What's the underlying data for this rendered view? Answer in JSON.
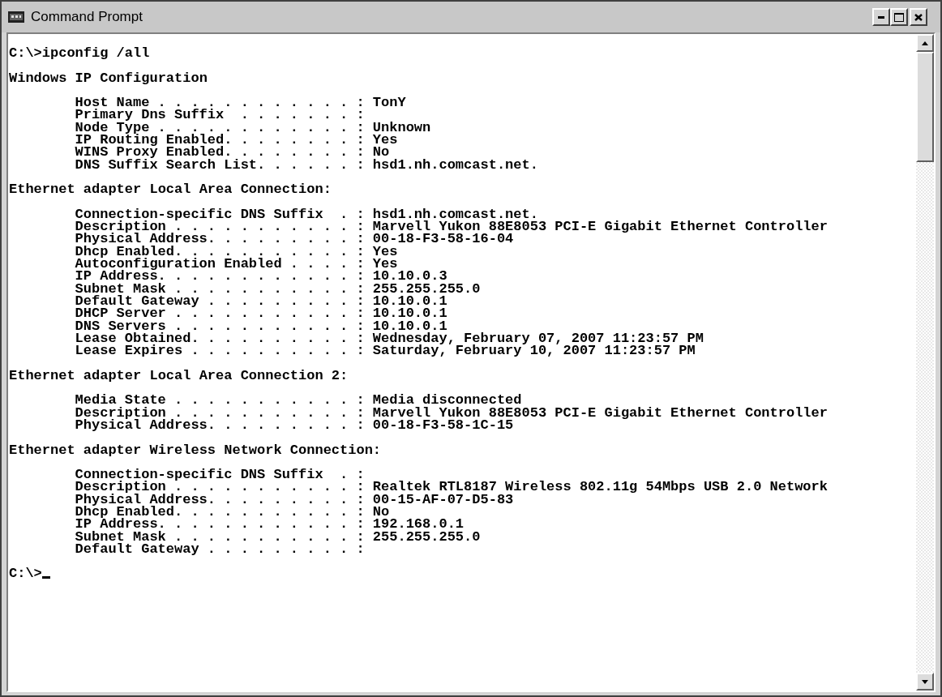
{
  "window": {
    "title": "Command Prompt"
  },
  "console": {
    "command_line": "C:\\>ipconfig /all",
    "sections": [
      {
        "heading": "Windows IP Configuration",
        "entries": [
          "Host Name . . . . . . . . . . . . : TonY",
          "Primary Dns Suffix  . . . . . . . :",
          "Node Type . . . . . . . . . . . . : Unknown",
          "IP Routing Enabled. . . . . . . . : Yes",
          "WINS Proxy Enabled. . . . . . . . : No",
          "DNS Suffix Search List. . . . . . : hsd1.nh.comcast.net."
        ]
      },
      {
        "heading": "Ethernet adapter Local Area Connection:",
        "entries": [
          "Connection-specific DNS Suffix  . : hsd1.nh.comcast.net.",
          "Description . . . . . . . . . . . : Marvell Yukon 88E8053 PCI-E Gigabit Ethernet Controller",
          "Physical Address. . . . . . . . . : 00-18-F3-58-16-04",
          "Dhcp Enabled. . . . . . . . . . . : Yes",
          "Autoconfiguration Enabled . . . . : Yes",
          "IP Address. . . . . . . . . . . . : 10.10.0.3",
          "Subnet Mask . . . . . . . . . . . : 255.255.255.0",
          "Default Gateway . . . . . . . . . : 10.10.0.1",
          "DHCP Server . . . . . . . . . . . : 10.10.0.1",
          "DNS Servers . . . . . . . . . . . : 10.10.0.1",
          "Lease Obtained. . . . . . . . . . : Wednesday, February 07, 2007 11:23:57 PM",
          "Lease Expires . . . . . . . . . . : Saturday, February 10, 2007 11:23:57 PM"
        ]
      },
      {
        "heading": "Ethernet adapter Local Area Connection 2:",
        "entries": [
          "Media State . . . . . . . . . . . : Media disconnected",
          "Description . . . . . . . . . . . : Marvell Yukon 88E8053 PCI-E Gigabit Ethernet Controller",
          "Physical Address. . . . . . . . . : 00-18-F3-58-1C-15"
        ]
      },
      {
        "heading": "Ethernet adapter Wireless Network Connection:",
        "entries": [
          "Connection-specific DNS Suffix  . :",
          "Description . . . . . . . . . . . : Realtek RTL8187 Wireless 802.11g 54Mbps USB 2.0 Network",
          "Physical Address. . . . . . . . . : 00-15-AF-07-D5-83",
          "Dhcp Enabled. . . . . . . . . . . : No",
          "IP Address. . . . . . . . . . . . : 192.168.0.1",
          "Subnet Mask . . . . . . . . . . . : 255.255.255.0",
          "Default Gateway . . . . . . . . . :"
        ]
      }
    ],
    "prompt": "C:\\>"
  }
}
